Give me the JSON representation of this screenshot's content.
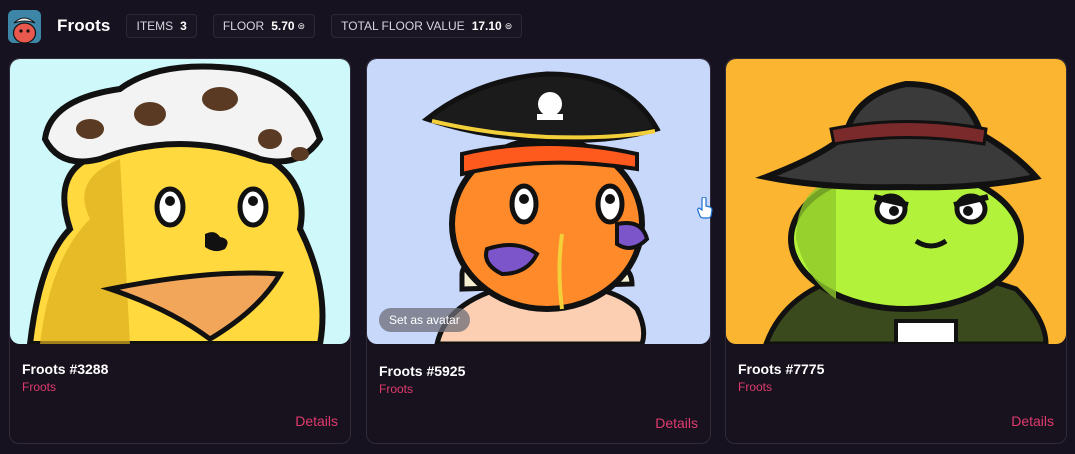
{
  "header": {
    "collection_name": "Froots",
    "stats": [
      {
        "label": "ITEMS",
        "value": "3",
        "eth": false
      },
      {
        "label": "FLOOR",
        "value": "5.70",
        "eth": true
      },
      {
        "label": "TOTAL FLOOR VALUE",
        "value": "17.10",
        "eth": true
      }
    ]
  },
  "colors": {
    "background": "#17121f",
    "accent": "#e03b6c",
    "card_border": "#302a3a"
  },
  "cards": [
    {
      "title": "Froots #3288",
      "collection": "Froots",
      "details_label": "Details",
      "background": "#cff8fb",
      "art": "yellow-froot-cowboy-hat"
    },
    {
      "title": "Froots #5925",
      "collection": "Froots",
      "details_label": "Details",
      "background": "#c8d8fb",
      "art": "orange-froot-pirate-hat",
      "hover_action": "Set as avatar"
    },
    {
      "title": "Froots #7775",
      "collection": "Froots",
      "details_label": "Details",
      "background": "#fbb530",
      "art": "green-froot-bucket-hat"
    }
  ]
}
